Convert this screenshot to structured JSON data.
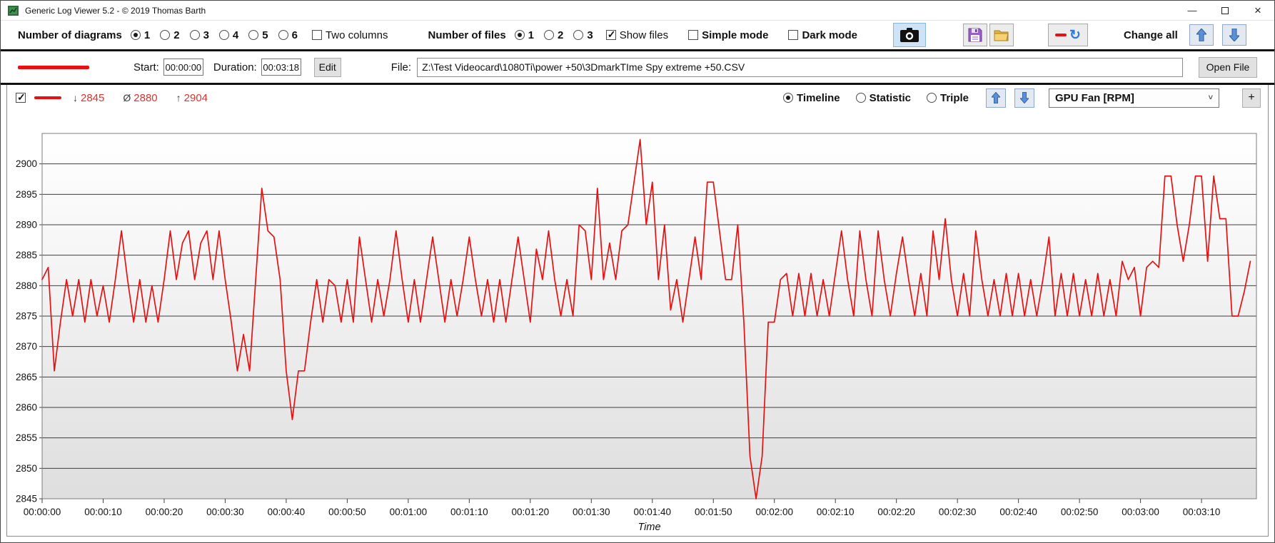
{
  "window": {
    "title": "Generic Log Viewer 5.2 - © 2019 Thomas Barth",
    "minimize": "—",
    "close": "×"
  },
  "toolbar": {
    "diagrams_label": "Number of diagrams",
    "diagram_options": [
      "1",
      "2",
      "3",
      "4",
      "5",
      "6"
    ],
    "diagrams_selected": "1",
    "two_columns_label": "Two columns",
    "files_label": "Number of files",
    "file_options": [
      "1",
      "2",
      "3"
    ],
    "files_selected": "1",
    "show_files_label": "Show files",
    "simple_mode_label": "Simple mode",
    "dark_mode_label": "Dark mode",
    "change_all_label": "Change all",
    "refresh_glyph": "↻"
  },
  "file_bar": {
    "start_label": "Start:",
    "start_value": "00:00:00",
    "duration_label": "Duration:",
    "duration_value": "00:03:18",
    "edit_label": "Edit",
    "file_label": "File:",
    "file_path": "Z:\\Test Videocard\\1080Ti\\power +50\\3DmarkTIme Spy extreme +50.CSV",
    "open_file_label": "Open File"
  },
  "chart_header": {
    "min": {
      "icon": "↓",
      "value": "2845"
    },
    "avg": {
      "icon": "Ø",
      "value": "2880"
    },
    "max": {
      "icon": "↑",
      "value": "2904"
    },
    "view_options": [
      "Timeline",
      "Statistic",
      "Triple"
    ],
    "view_selected": "Timeline",
    "signal_selected": "GPU Fan [RPM]",
    "select_chevron": "˅",
    "add_button": "+"
  },
  "chart_data": {
    "type": "line",
    "title": "",
    "xlabel": "Time",
    "ylabel": "",
    "ylim": [
      2845,
      2905
    ],
    "y_ticks": [
      2845,
      2850,
      2855,
      2860,
      2865,
      2870,
      2875,
      2880,
      2885,
      2890,
      2895,
      2900
    ],
    "x_range_seconds": [
      0,
      199
    ],
    "x_tick_interval_seconds": 10,
    "x_tick_labels": [
      "00:00:00",
      "00:00:10",
      "00:00:20",
      "00:00:30",
      "00:00:40",
      "00:00:50",
      "00:01:00",
      "00:01:10",
      "00:01:20",
      "00:01:30",
      "00:01:40",
      "00:01:50",
      "00:02:00",
      "00:02:10",
      "00:02:20",
      "00:02:30",
      "00:02:40",
      "00:02:50",
      "00:03:00",
      "00:03:10"
    ],
    "grid": "horizontal",
    "legend_position": "none",
    "series": [
      {
        "name": "GPU Fan [RPM]",
        "color": "#e81010",
        "sample_interval_seconds": 1,
        "values": [
          2881,
          2883,
          2866,
          2874,
          2881,
          2875,
          2881,
          2874,
          2881,
          2875,
          2880,
          2874,
          2881,
          2889,
          2881,
          2874,
          2881,
          2874,
          2880,
          2874,
          2881,
          2889,
          2881,
          2887,
          2889,
          2881,
          2887,
          2889,
          2881,
          2889,
          2881,
          2874,
          2866,
          2872,
          2866,
          2881,
          2896,
          2889,
          2888,
          2881,
          2866,
          2858,
          2866,
          2866,
          2874,
          2881,
          2874,
          2881,
          2880,
          2874,
          2881,
          2874,
          2888,
          2881,
          2874,
          2881,
          2875,
          2881,
          2889,
          2881,
          2874,
          2881,
          2874,
          2881,
          2888,
          2881,
          2874,
          2881,
          2875,
          2881,
          2888,
          2881,
          2875,
          2881,
          2874,
          2881,
          2874,
          2881,
          2888,
          2881,
          2874,
          2886,
          2881,
          2889,
          2881,
          2875,
          2881,
          2875,
          2890,
          2889,
          2881,
          2896,
          2881,
          2887,
          2881,
          2889,
          2890,
          2897,
          2904,
          2890,
          2897,
          2881,
          2890,
          2876,
          2881,
          2874,
          2881,
          2888,
          2881,
          2897,
          2897,
          2889,
          2881,
          2881,
          2890,
          2874,
          2852,
          2845,
          2852,
          2874,
          2874,
          2881,
          2882,
          2875,
          2882,
          2875,
          2882,
          2875,
          2881,
          2875,
          2882,
          2889,
          2881,
          2875,
          2889,
          2881,
          2875,
          2889,
          2881,
          2875,
          2882,
          2888,
          2881,
          2875,
          2882,
          2875,
          2889,
          2881,
          2891,
          2881,
          2875,
          2882,
          2875,
          2889,
          2881,
          2875,
          2881,
          2875,
          2882,
          2875,
          2882,
          2875,
          2881,
          2875,
          2881,
          2888,
          2875,
          2882,
          2875,
          2882,
          2875,
          2881,
          2875,
          2882,
          2875,
          2881,
          2875,
          2884,
          2881,
          2883,
          2875,
          2883,
          2884,
          2883,
          2898,
          2898,
          2890,
          2884,
          2890,
          2898,
          2898,
          2884,
          2898,
          2891,
          2891,
          2875,
          2875,
          2879,
          2884
        ]
      }
    ]
  }
}
